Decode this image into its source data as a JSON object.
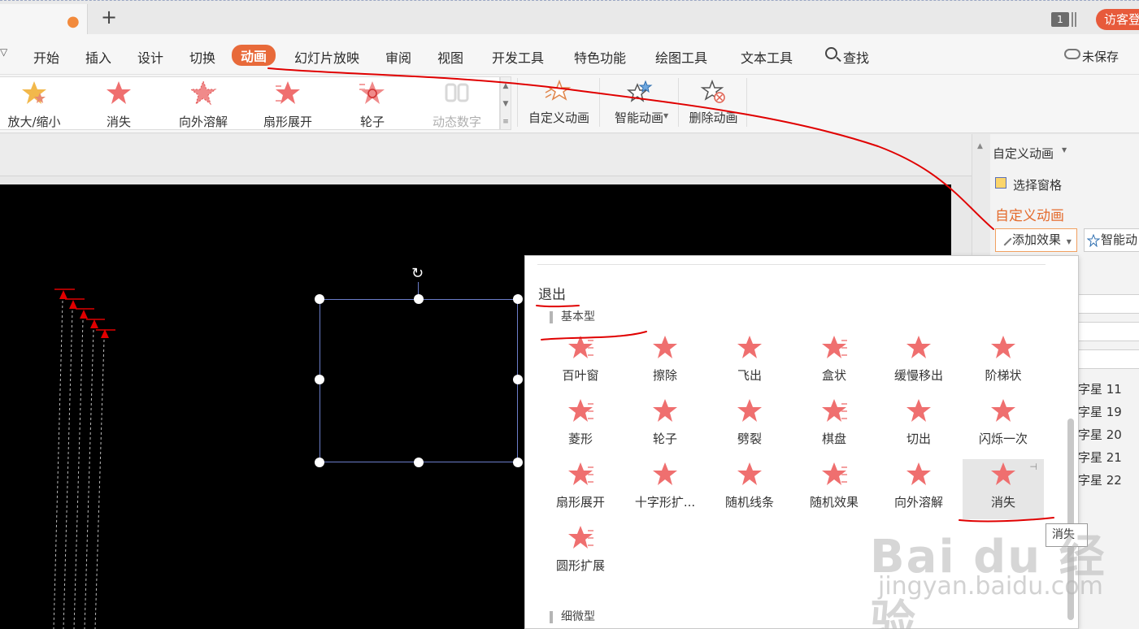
{
  "tabbar": {
    "new_tab_label": "+",
    "window_badge": "1",
    "visitor_label": "访客登"
  },
  "menu": {
    "items": [
      "开始",
      "插入",
      "设计",
      "切换",
      "动画",
      "幻灯片放映",
      "审阅",
      "视图",
      "开发工具",
      "特色功能",
      "绘图工具",
      "文本工具"
    ],
    "active": "动画",
    "search_label": "查找",
    "unsaved_label": "未保存"
  },
  "ribbon": {
    "gallery": [
      {
        "label": "放大/缩小",
        "icon": "zoom-star-icon",
        "disabled": false
      },
      {
        "label": "消失",
        "icon": "disappear-star-icon",
        "disabled": false
      },
      {
        "label": "向外溶解",
        "icon": "dissolve-star-icon",
        "disabled": false
      },
      {
        "label": "扇形展开",
        "icon": "fan-star-icon",
        "disabled": false
      },
      {
        "label": "轮子",
        "icon": "wheel-star-icon",
        "disabled": false
      },
      {
        "label": "动态数字",
        "icon": "dynamic-number-icon",
        "disabled": true
      }
    ],
    "buttons": [
      {
        "label": "自定义动画",
        "icon": "custom-animation-icon"
      },
      {
        "label": "智能动画",
        "icon": "smart-animation-icon"
      },
      {
        "label": "删除动画",
        "icon": "delete-animation-icon"
      }
    ]
  },
  "pane": {
    "title": "自定义动画",
    "select_pane": "选择窗格",
    "heading": "自定义动画",
    "add_effect": "添加效果",
    "smart_animation": "智能动",
    "list": [
      "字星 11",
      "字星 19",
      "字星 20",
      "字星 21",
      "字星 22"
    ]
  },
  "popup": {
    "category": "退出",
    "basic_group": "基本型",
    "subtle_group": "细微型",
    "effects": [
      "百叶窗",
      "擦除",
      "飞出",
      "盒状",
      "缓慢移出",
      "阶梯状",
      "菱形",
      "轮子",
      "劈裂",
      "棋盘",
      "切出",
      "闪烁一次",
      "扇形展开",
      "十字形扩...",
      "随机线条",
      "随机效果",
      "向外溶解",
      "消失",
      "圆形扩展"
    ],
    "hovered": "消失",
    "tooltip": "消失"
  },
  "colors": {
    "accent": "#e86a3a",
    "star": "#ef6f6f",
    "annotation": "#e00000"
  }
}
